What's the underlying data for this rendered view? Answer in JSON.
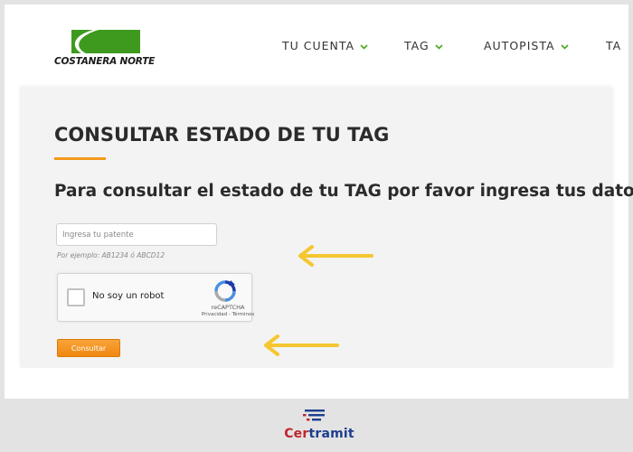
{
  "header": {
    "logo_text": "COSTANERA NORTE",
    "nav": [
      {
        "label": "TU CUENTA"
      },
      {
        "label": "TAG"
      },
      {
        "label": "AUTOPISTA"
      },
      {
        "label": "TA"
      }
    ]
  },
  "page": {
    "title": "CONSULTAR ESTADO DE TU TAG",
    "subtitle": "Para consultar el estado de tu TAG por favor ingresa tus datos",
    "plate_input": {
      "placeholder": "Ingresa tu patente",
      "value": ""
    },
    "hint": "Por ejemplo: AB1234 ó ABCD12",
    "recaptcha": {
      "label": "No soy un robot",
      "brand": "reCAPTCHA",
      "links": "Privacidad - Términos"
    },
    "submit_label": "Consultar"
  },
  "footer": {
    "brand_part1": "Cer",
    "brand_part2": "tramit"
  },
  "colors": {
    "accent_orange": "#f39a1d",
    "brand_green": "#3e9a1f",
    "arrow_yellow": "#f5c730",
    "certramit_red": "#c0262d",
    "certramit_blue": "#1d3e8e"
  },
  "icons": [
    "costanera-logo-icon",
    "chevron-down-icon",
    "recaptcha-icon",
    "arrow-left-icon",
    "certramit-logo-icon"
  ]
}
